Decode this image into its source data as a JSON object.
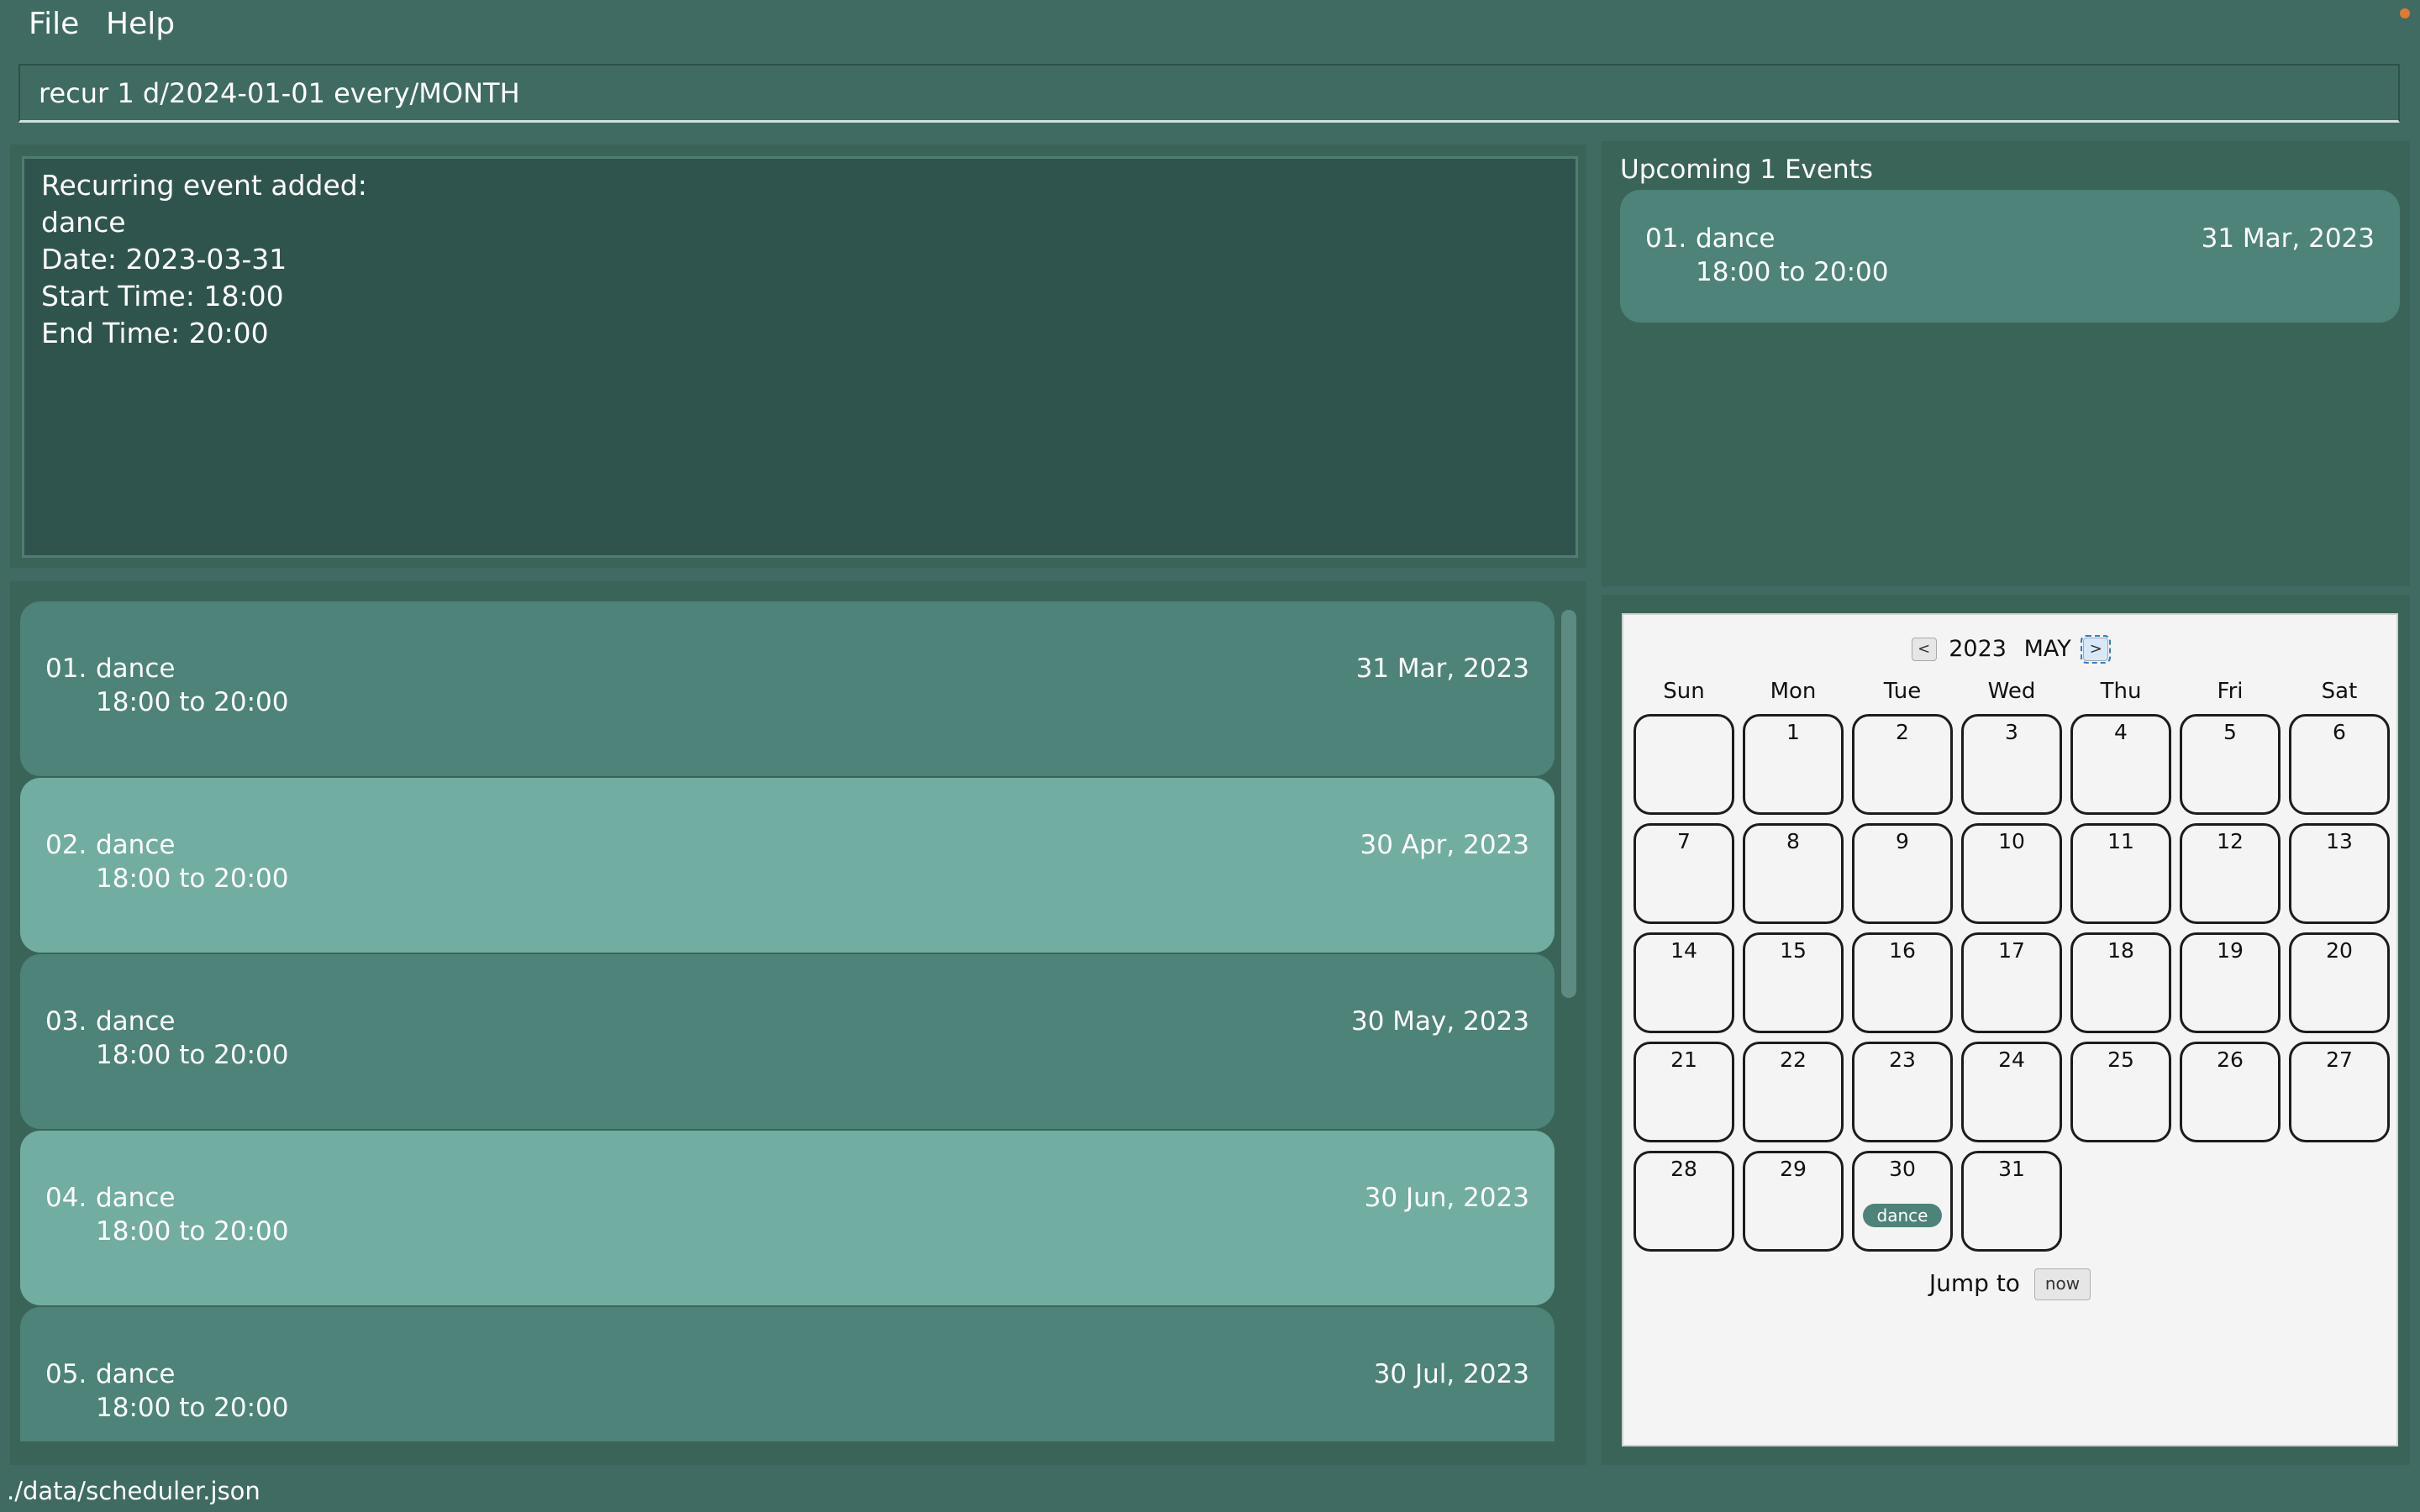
{
  "menu": {
    "file": "File",
    "help": "Help"
  },
  "command": {
    "value": "recur 1 d/2024-01-01 every/MONTH"
  },
  "result": {
    "lines": [
      "Recurring event added:",
      "dance",
      "Date: 2023-03-31",
      "Start Time: 18:00",
      "End Time: 20:00"
    ]
  },
  "events": [
    {
      "index": "01.",
      "name": "dance",
      "time": "18:00  to  20:00",
      "date": "31 Mar, 2023"
    },
    {
      "index": "02.",
      "name": "dance",
      "time": "18:00  to  20:00",
      "date": "30 Apr, 2023"
    },
    {
      "index": "03.",
      "name": "dance",
      "time": "18:00  to  20:00",
      "date": "30 May, 2023"
    },
    {
      "index": "04.",
      "name": "dance",
      "time": "18:00  to  20:00",
      "date": "30 Jun, 2023"
    },
    {
      "index": "05.",
      "name": "dance",
      "time": "18:00  to  20:00",
      "date": "30 Jul, 2023"
    }
  ],
  "upcoming": {
    "title": "Upcoming 1 Events",
    "items": [
      {
        "index": "01.",
        "name": "dance",
        "time": "18:00  to  20:00",
        "date": "31 Mar, 2023"
      }
    ]
  },
  "calendar": {
    "prev": "<",
    "next": ">",
    "year": "2023",
    "month": "MAY",
    "weekdays": [
      "Sun",
      "Mon",
      "Tue",
      "Wed",
      "Thu",
      "Fri",
      "Sat"
    ],
    "days": [
      {
        "num": "",
        "event": ""
      },
      {
        "num": "1",
        "event": ""
      },
      {
        "num": "2",
        "event": ""
      },
      {
        "num": "3",
        "event": ""
      },
      {
        "num": "4",
        "event": ""
      },
      {
        "num": "5",
        "event": ""
      },
      {
        "num": "6",
        "event": ""
      },
      {
        "num": "7",
        "event": ""
      },
      {
        "num": "8",
        "event": ""
      },
      {
        "num": "9",
        "event": ""
      },
      {
        "num": "10",
        "event": ""
      },
      {
        "num": "11",
        "event": ""
      },
      {
        "num": "12",
        "event": ""
      },
      {
        "num": "13",
        "event": ""
      },
      {
        "num": "14",
        "event": ""
      },
      {
        "num": "15",
        "event": ""
      },
      {
        "num": "16",
        "event": ""
      },
      {
        "num": "17",
        "event": ""
      },
      {
        "num": "18",
        "event": ""
      },
      {
        "num": "19",
        "event": ""
      },
      {
        "num": "20",
        "event": ""
      },
      {
        "num": "21",
        "event": ""
      },
      {
        "num": "22",
        "event": ""
      },
      {
        "num": "23",
        "event": ""
      },
      {
        "num": "24",
        "event": ""
      },
      {
        "num": "25",
        "event": ""
      },
      {
        "num": "26",
        "event": ""
      },
      {
        "num": "27",
        "event": ""
      },
      {
        "num": "28",
        "event": ""
      },
      {
        "num": "29",
        "event": ""
      },
      {
        "num": "30",
        "event": "dance"
      },
      {
        "num": "31",
        "event": ""
      }
    ],
    "jump_label": "Jump to",
    "now_label": "now"
  },
  "status": {
    "path": "./data/scheduler.json"
  },
  "colors": {
    "background": "#3f6b62",
    "card_dark": "#4d8379",
    "card_light": "#72ada2",
    "result_bg": "#2f544d"
  }
}
